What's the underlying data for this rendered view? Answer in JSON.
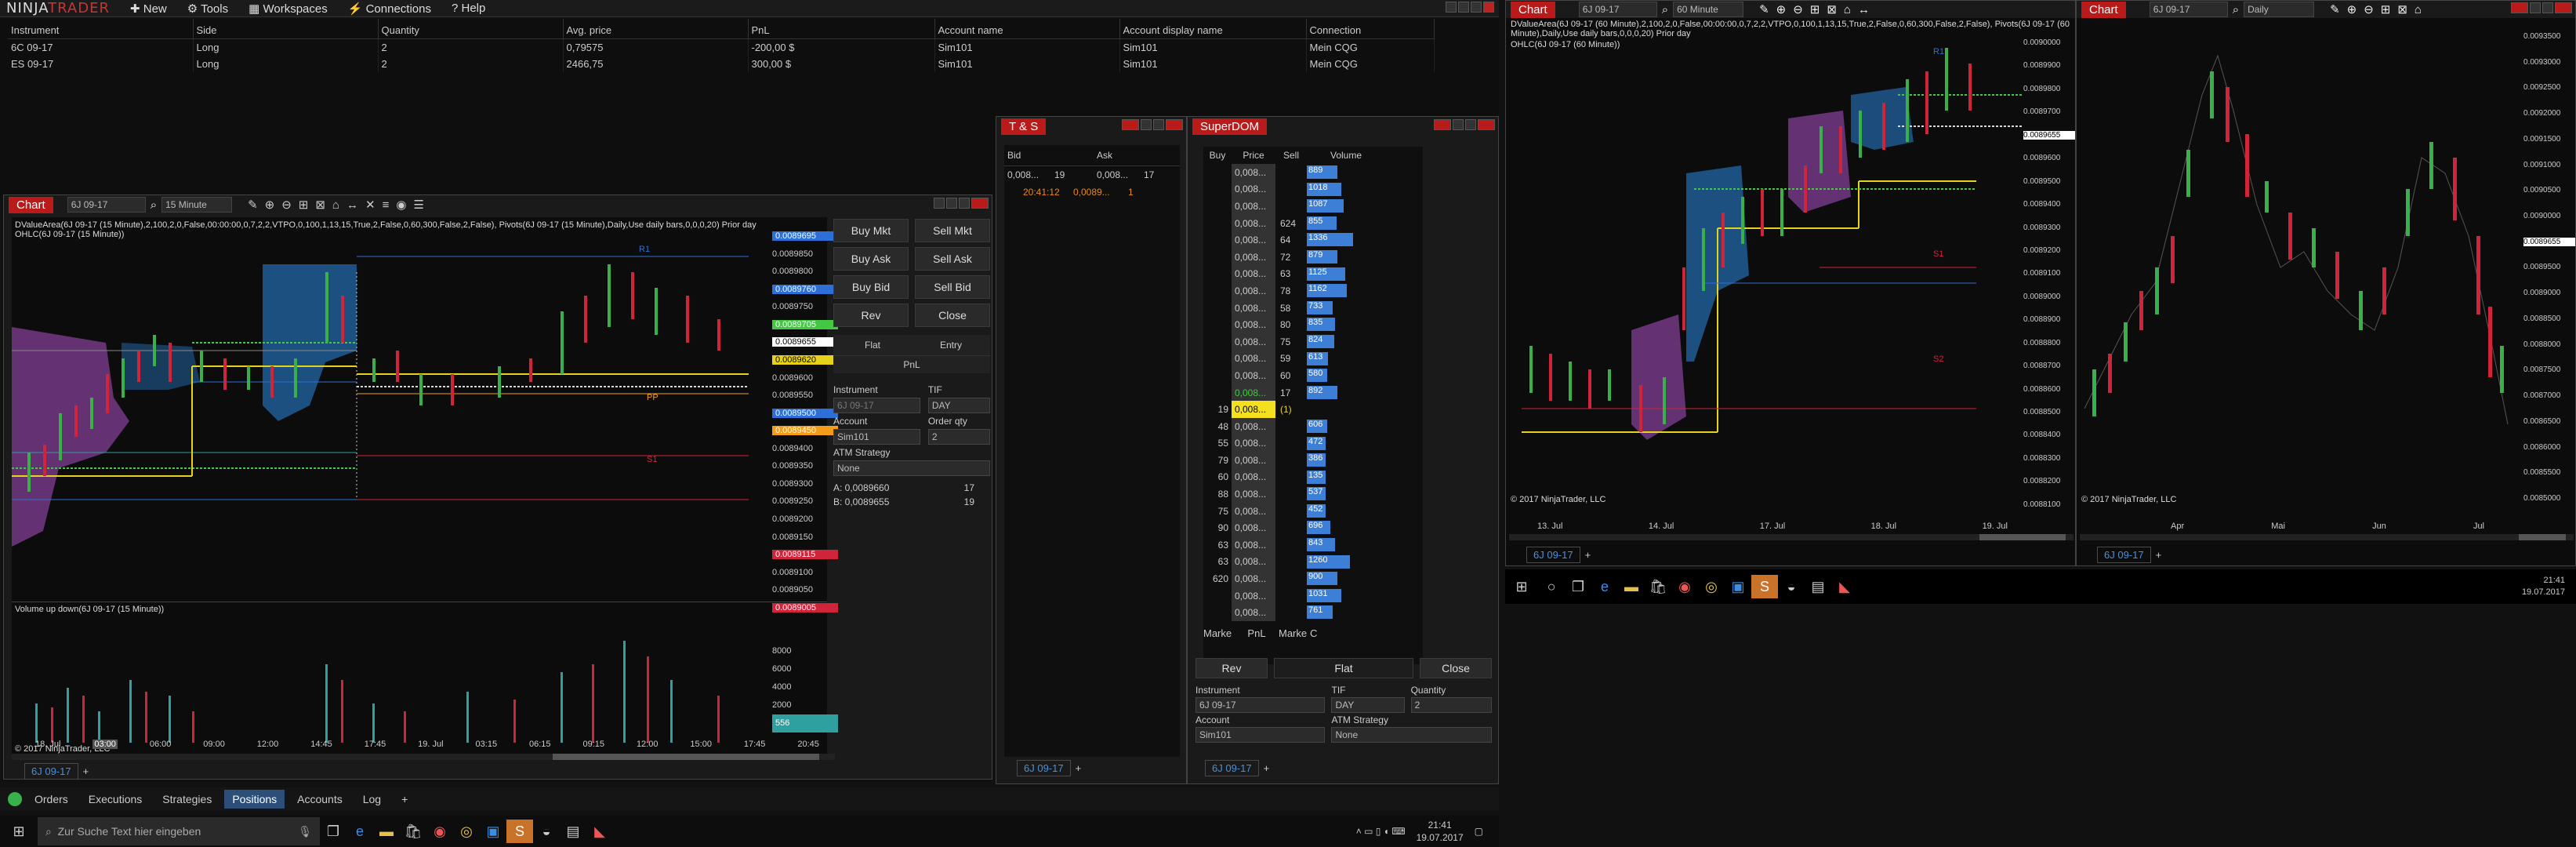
{
  "app": {
    "logo_main": "NINJA",
    "logo_accent": "TRADER",
    "menu": [
      {
        "label": "New"
      },
      {
        "label": "Tools"
      },
      {
        "label": "Workspaces"
      },
      {
        "label": "Connections"
      },
      {
        "label": "Help"
      }
    ]
  },
  "positions": {
    "headers": [
      "Instrument",
      "Side",
      "Quantity",
      "Avg. price",
      "PnL",
      "Account name",
      "Account display name",
      "Connection"
    ],
    "rows": [
      [
        "6C 09-17",
        "Long",
        "2",
        "0,79575",
        "-200,00 $",
        "Sim101",
        "Sim101",
        "Mein CQG"
      ],
      [
        "ES 09-17",
        "Long",
        "2",
        "2466,75",
        "300,00 $",
        "Sim101",
        "Sim101",
        "Mein CQG"
      ]
    ],
    "tabs": [
      {
        "label": "Orders"
      },
      {
        "label": "Executions"
      },
      {
        "label": "Strategies"
      },
      {
        "label": "Positions"
      },
      {
        "label": "Accounts"
      },
      {
        "label": "Log"
      }
    ],
    "add": "+"
  },
  "chart1": {
    "title": "Chart",
    "instrument": "6J 09-17",
    "interval": "15 Minute",
    "indicator_line1": "DValueArea(6J 09-17 (15 Minute),2,100,2,0,False,00:00:00,0,7,2,2,VTPO,0,100,1,13,15,True,2,False,0,60,300,False,2,False), Pivots(6J 09-17 (15 Minute),Daily,Use daily bars,0,0,0,20)  Prior day",
    "indicator_line2": "OHLC(6J 09-17 (15 Minute))",
    "price_labels": [
      {
        "v": "0.0089695",
        "c": "#2d6fd6"
      },
      {
        "v": "0.0089850",
        "c": ""
      },
      {
        "v": "0.0089800",
        "c": ""
      },
      {
        "v": "0.0089760",
        "c": "#2d6fd6"
      },
      {
        "v": "0.0089750",
        "c": ""
      },
      {
        "v": "0.0089705",
        "c": "#43c843"
      },
      {
        "v": "0.0089655",
        "c": "#fff"
      },
      {
        "v": "0.0089620",
        "c": "#e6d21a"
      },
      {
        "v": "0.0089600",
        "c": ""
      },
      {
        "v": "0.0089550",
        "c": ""
      },
      {
        "v": "0.0089500",
        "c": "#2d6fd6"
      },
      {
        "v": "0.0089450",
        "c": "#f39c1a"
      },
      {
        "v": "0.0089400",
        "c": ""
      },
      {
        "v": "0.0089350",
        "c": ""
      },
      {
        "v": "0.0089300",
        "c": ""
      },
      {
        "v": "0.0089250",
        "c": ""
      },
      {
        "v": "0.0089200",
        "c": ""
      },
      {
        "v": "0.0089150",
        "c": ""
      },
      {
        "v": "0.0089115",
        "c": "#d0243a"
      },
      {
        "v": "0.0089100",
        "c": ""
      },
      {
        "v": "0.0089050",
        "c": ""
      },
      {
        "v": "0.0089005",
        "c": "#d0243a"
      }
    ],
    "pivot_labels": {
      "r1": "R1",
      "pp": "PP",
      "s1": "S1"
    },
    "volume_title": "Volume up down(6J 09-17 (15 Minute))",
    "volume_axis": [
      "8000",
      "6000",
      "4000",
      "2000",
      "0"
    ],
    "volume_last": "556",
    "copyright": "© 2017 NinjaTrader, LLC",
    "x_labels": [
      "18. Jul",
      "03:00",
      "06:00",
      "09:00",
      "12:00",
      "14:45",
      "17:45",
      "19. Jul",
      "03:15",
      "06:15",
      "09:15",
      "12:00",
      "15:00",
      "17:45",
      "20:45"
    ],
    "tab_label": "6J 09-17",
    "chart_tabs_add": "+"
  },
  "chart_trader": {
    "buttons": {
      "buy_mkt": "Buy Mkt",
      "sell_mkt": "Sell Mkt",
      "buy_ask": "Buy Ask",
      "sell_ask": "Sell Ask",
      "buy_bid": "Buy Bid",
      "sell_bid": "Sell Bid",
      "rev": "Rev",
      "close": "Close"
    },
    "flat": "Flat",
    "entry": "Entry",
    "pnl": "PnL",
    "instrument_label": "Instrument",
    "instrument_value": "6J 09-17",
    "tif_label": "TIF",
    "tif_value": "DAY",
    "account_label": "Account",
    "account_value": "Sim101",
    "qty_label": "Order qty",
    "qty_value": "2",
    "atm_label": "ATM Strategy",
    "atm_value": "None",
    "a_line": "A:  0,0089660",
    "a_qty": "17",
    "b_line": "B:  0,0089655",
    "b_qty": "19"
  },
  "ts": {
    "title": "T & S",
    "headers": [
      "Bid",
      "Ask"
    ],
    "row1": {
      "bid": "0,008...",
      "bid_sz": "19",
      "ask": "0,008...",
      "ask_sz": "17"
    },
    "row2": {
      "time": "20:41:12",
      "price": "0,0089...",
      "size": "1"
    },
    "tab": "6J 09-17",
    "add": "+"
  },
  "superdom": {
    "title": "SuperDOM",
    "headers": [
      "Buy",
      "Price",
      "Sell",
      "Volume"
    ],
    "rows": [
      {
        "buy": "",
        "price": "0,008...",
        "sell": "",
        "vol": "889",
        "w": 0.3
      },
      {
        "buy": "",
        "price": "0,008...",
        "sell": "",
        "vol": "1018",
        "w": 0.34
      },
      {
        "buy": "",
        "price": "0,008...",
        "sell": "",
        "vol": "1087",
        "w": 0.36
      },
      {
        "buy": "",
        "price": "0,008...",
        "sell": "624",
        "vol": "855",
        "w": 0.29
      },
      {
        "buy": "",
        "price": "0,008...",
        "sell": "64",
        "vol": "1336",
        "w": 0.45
      },
      {
        "buy": "",
        "price": "0,008...",
        "sell": "72",
        "vol": "879",
        "w": 0.3
      },
      {
        "buy": "",
        "price": "0,008...",
        "sell": "63",
        "vol": "1125",
        "w": 0.38
      },
      {
        "buy": "",
        "price": "0,008...",
        "sell": "78",
        "vol": "1162",
        "w": 0.39
      },
      {
        "buy": "",
        "price": "0,008...",
        "sell": "58",
        "vol": "733",
        "w": 0.25
      },
      {
        "buy": "",
        "price": "0,008...",
        "sell": "80",
        "vol": "835",
        "w": 0.28
      },
      {
        "buy": "",
        "price": "0,008...",
        "sell": "75",
        "vol": "824",
        "w": 0.27
      },
      {
        "buy": "",
        "price": "0,008...",
        "sell": "59",
        "vol": "613",
        "w": 0.21
      },
      {
        "buy": "",
        "price": "0,008...",
        "sell": "60",
        "vol": "580",
        "w": 0.2
      },
      {
        "buy": "",
        "price": "0,008...",
        "sell": "17",
        "vol": "892",
        "w": 0.3
      },
      {
        "buy": "19",
        "price": "0,008...",
        "sell": "(1)",
        "vol": "",
        "w": 0
      },
      {
        "buy": "48",
        "price": "0,008...",
        "sell": "",
        "vol": "606",
        "w": 0.2
      },
      {
        "buy": "55",
        "price": "0,008...",
        "sell": "",
        "vol": "472",
        "w": 0.16
      },
      {
        "buy": "79",
        "price": "0,008...",
        "sell": "",
        "vol": "386",
        "w": 0.13
      },
      {
        "buy": "60",
        "price": "0,008...",
        "sell": "",
        "vol": "135",
        "w": 0.05
      },
      {
        "buy": "88",
        "price": "0,008...",
        "sell": "",
        "vol": "537",
        "w": 0.18
      },
      {
        "buy": "75",
        "price": "0,008...",
        "sell": "",
        "vol": "452",
        "w": 0.15
      },
      {
        "buy": "90",
        "price": "0,008...",
        "sell": "",
        "vol": "696",
        "w": 0.23
      },
      {
        "buy": "63",
        "price": "0,008...",
        "sell": "",
        "vol": "843",
        "w": 0.28
      },
      {
        "buy": "63",
        "price": "0,008...",
        "sell": "",
        "vol": "1260",
        "w": 0.42
      },
      {
        "buy": "620",
        "price": "0,008...",
        "sell": "",
        "vol": "900",
        "w": 0.3
      },
      {
        "buy": "",
        "price": "0,008...",
        "sell": "",
        "vol": "1031",
        "w": 0.34
      },
      {
        "buy": "",
        "price": "0,008...",
        "sell": "",
        "vol": "761",
        "w": 0.25
      }
    ],
    "footer": {
      "buy_market": "Marke",
      "pnl": "PnL",
      "sell_market": "Marke",
      "c": "C"
    },
    "rev": "Rev",
    "flat": "Flat",
    "close": "Close",
    "instrument_label": "Instrument",
    "instrument_value": "6J 09-17",
    "tif_label": "TIF",
    "tif_value": "DAY",
    "qty_label": "Quantity",
    "qty_value": "2",
    "account_label": "Account",
    "account_value": "Sim101",
    "atm_label": "ATM Strategy",
    "atm_value": "None",
    "tab": "6J 09-17",
    "add": "+"
  },
  "chart2": {
    "title": "Chart",
    "instrument": "6J 09-17",
    "interval": "60 Minute",
    "indicator_line1": "DValueArea(6J 09-17 (60 Minute),2,100,2,0,False,00:00:00,0,7,2,2,VTPO,0,100,1,13,15,True,2,False,0,60,300,False,2,False), Pivots(6J 09-17 (60 Minute),Daily,Use daily bars,0,0,0,20)  Prior day",
    "indicator_line2": "OHLC(6J 09-17 (60 Minute))",
    "y_labels": [
      "0.0090000",
      "0.0089900",
      "0.0089800",
      "0.0089700",
      "0.0089600",
      "0.0089500",
      "0.0089400",
      "0.0089300",
      "0.0089200",
      "0.0089100",
      "0.0089000",
      "0.0088900",
      "0.0088800",
      "0.0088700",
      "0.0088600",
      "0.0088500",
      "0.0088400",
      "0.0088300",
      "0.0088200",
      "0.0088100"
    ],
    "last_price": "0.0089655",
    "pivot_labels": {
      "r1": "R1",
      "s1": "S1",
      "s2": "S2"
    },
    "x_labels": [
      "13. Jul",
      "14. Jul",
      "17. Jul",
      "18. Jul",
      "19. Jul"
    ],
    "copyright": "© 2017 NinjaTrader, LLC",
    "tab": "6J 09-17",
    "add": "+"
  },
  "chart3": {
    "title": "Chart",
    "instrument": "6J 09-17",
    "interval": "Daily",
    "y_labels": [
      "0.0093500",
      "0.0093000",
      "0.0092500",
      "0.0092000",
      "0.0091500",
      "0.0091000",
      "0.0090500",
      "0.0090000",
      "0.0089500",
      "0.0089000",
      "0.0088500",
      "0.0088000",
      "0.0087500",
      "0.0087000",
      "0.0086500",
      "0.0086000",
      "0.0085500",
      "0.0085000"
    ],
    "last_price": "0.0089655",
    "x_labels": [
      "Apr",
      "Mai",
      "Jun",
      "Jul"
    ],
    "copyright": "© 2017 NinjaTrader, LLC",
    "tab": "6J 09-17",
    "add": "+"
  },
  "taskbar_left": {
    "search": "Zur Suche Text hier eingeben",
    "time": "21:41",
    "date": "19.07.2017"
  },
  "taskbar_right": {
    "time": "21:41",
    "date": "19.07.2017"
  }
}
